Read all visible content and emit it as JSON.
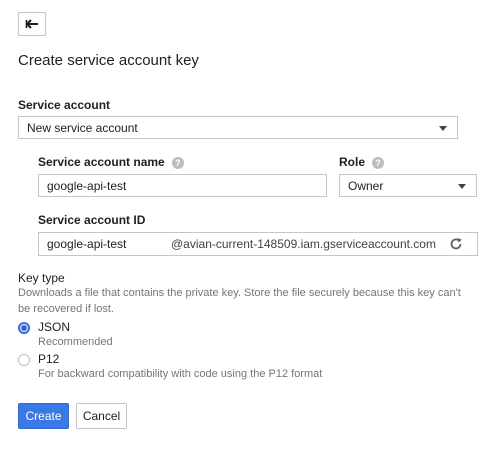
{
  "page": {
    "title": "Create service account key"
  },
  "service_account": {
    "label": "Service account",
    "selected": "New service account"
  },
  "name_field": {
    "label": "Service account name",
    "value": "google-api-test"
  },
  "role_field": {
    "label": "Role",
    "selected": "Owner"
  },
  "id_field": {
    "label": "Service account ID",
    "value": "google-api-test",
    "suffix": "@avian-current-148509.iam.gserviceaccount.com"
  },
  "key_type": {
    "label": "Key type",
    "description": "Downloads a file that contains the private key. Store the file securely because this key can't be recovered if lost.",
    "options": [
      {
        "label": "JSON",
        "sub": "Recommended",
        "selected": true
      },
      {
        "label": "P12",
        "sub": "For backward compatibility with code using the P12 format",
        "selected": false
      }
    ]
  },
  "actions": {
    "create": "Create",
    "cancel": "Cancel"
  },
  "icons": {
    "back": "arrow-back-icon",
    "help": "help-icon",
    "refresh": "refresh-icon",
    "dropdown": "chevron-down-icon"
  },
  "colors": {
    "accent": "#3b78e7",
    "help_icon": "#bdbdbd",
    "secondary_text": "#757575"
  }
}
